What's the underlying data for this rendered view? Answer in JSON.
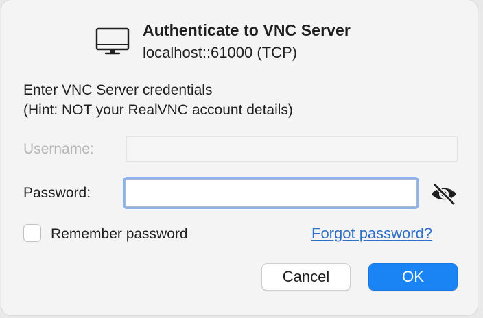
{
  "dialog": {
    "title": "Authenticate to VNC Server",
    "subtitle": "localhost::61000 (TCP)",
    "icon": "monitor-icon",
    "prompt_line1": "Enter VNC Server credentials",
    "prompt_line2": "(Hint: NOT your RealVNC account details)"
  },
  "form": {
    "username_label": "Username:",
    "username_value": "",
    "password_label": "Password:",
    "password_value": "",
    "show_password_icon": "eye-slash-icon",
    "remember_label": "Remember password",
    "remember_checked": false,
    "forgot_link": "Forgot password?"
  },
  "buttons": {
    "cancel_label": "Cancel",
    "ok_label": "OK"
  },
  "colors": {
    "accent": "#1b84f5",
    "link": "#2e6fc9",
    "focus_ring": "#8eb3eb"
  }
}
